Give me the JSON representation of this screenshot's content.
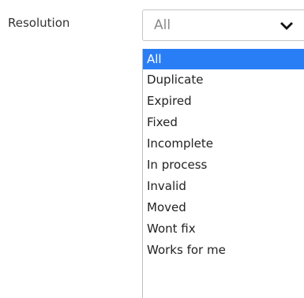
{
  "field": {
    "label": "Resolution",
    "selected_value": "All",
    "dropdown_icon": "chevron-down-icon"
  },
  "dropdown": {
    "options": [
      {
        "label": "All",
        "selected": true
      },
      {
        "label": "Duplicate",
        "selected": false
      },
      {
        "label": "Expired",
        "selected": false
      },
      {
        "label": "Fixed",
        "selected": false
      },
      {
        "label": "Incomplete",
        "selected": false
      },
      {
        "label": "In process",
        "selected": false
      },
      {
        "label": "Invalid",
        "selected": false
      },
      {
        "label": "Moved",
        "selected": false
      },
      {
        "label": "Wont fix",
        "selected": false
      },
      {
        "label": "Works for me",
        "selected": false
      }
    ],
    "highlight_color": "#2a7ef5"
  }
}
